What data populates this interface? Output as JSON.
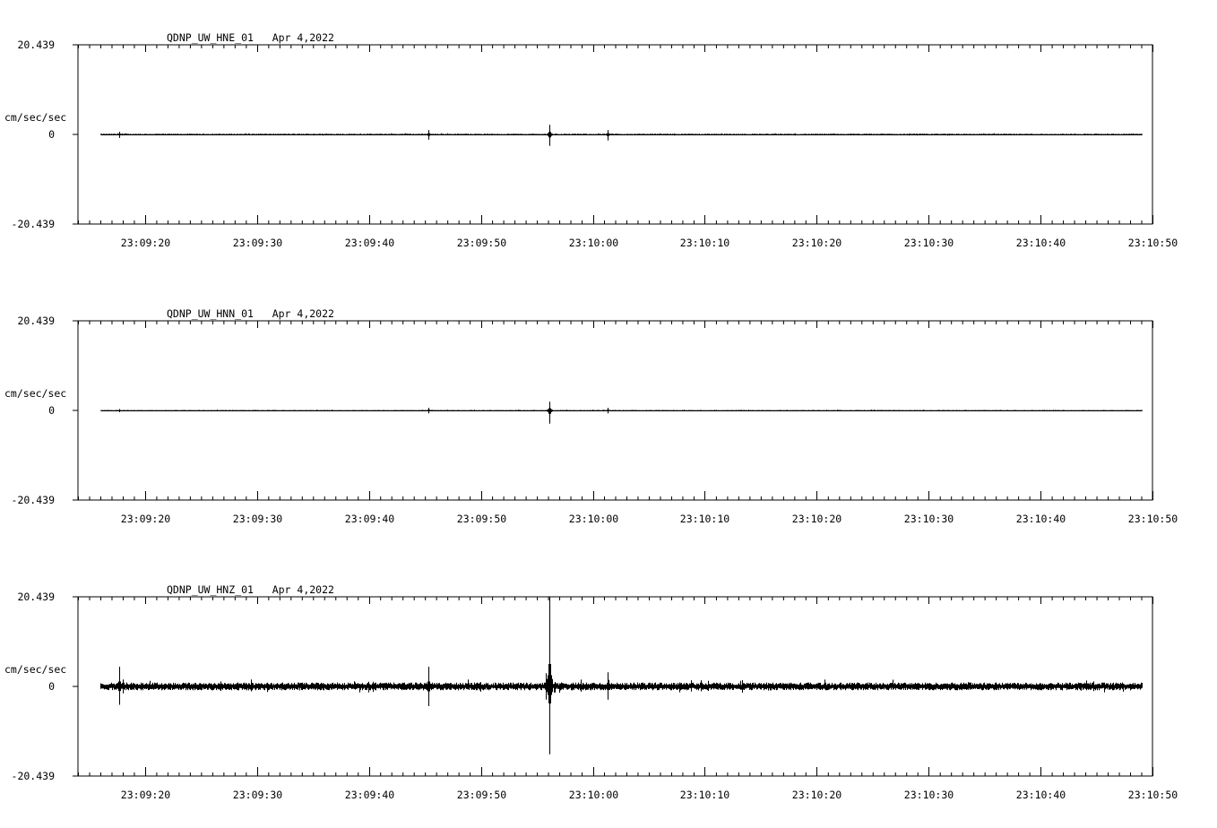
{
  "chart_data": [
    {
      "type": "line",
      "title": "QDNP_UW_HNE_01   Apr 4,2022",
      "ylabel": "cm/sec/sec",
      "ylim": [
        -20.439,
        20.439
      ],
      "ytick_labels": [
        "20.439",
        "0",
        "-20.439"
      ],
      "xlim": [
        "23:09:14",
        "23:10:50"
      ],
      "xtick_labels": [
        "23:09:20",
        "23:09:30",
        "23:09:40",
        "23:09:50",
        "23:10:00",
        "23:10:10",
        "23:10:20",
        "23:10:30",
        "23:10:40",
        "23:10:50"
      ],
      "x_range": [
        "23:09:16",
        "23:10:49"
      ],
      "noise_amplitude": 0.15,
      "spikes": [
        {
          "t": "23:09:17.7",
          "max": 0.6,
          "min": -0.8
        },
        {
          "t": "23:09:45.3",
          "max": 1.0,
          "min": -1.2
        },
        {
          "t": "23:09:56.1",
          "max": 2.2,
          "min": -2.6
        },
        {
          "t": "23:10:01.3",
          "max": 1.0,
          "min": -1.4
        }
      ]
    },
    {
      "type": "line",
      "title": "QDNP_UW_HNN_01   Apr 4,2022",
      "ylabel": "cm/sec/sec",
      "ylim": [
        -20.439,
        20.439
      ],
      "ytick_labels": [
        "20.439",
        "0",
        "-20.439"
      ],
      "xlim": [
        "23:09:14",
        "23:10:50"
      ],
      "xtick_labels": [
        "23:09:20",
        "23:09:30",
        "23:09:40",
        "23:09:50",
        "23:10:00",
        "23:10:10",
        "23:10:20",
        "23:10:30",
        "23:10:40",
        "23:10:50"
      ],
      "x_range": [
        "23:09:16",
        "23:10:49"
      ],
      "noise_amplitude": 0.1,
      "spikes": [
        {
          "t": "23:09:17.7",
          "max": 0.3,
          "min": -0.4
        },
        {
          "t": "23:09:45.3",
          "max": 0.6,
          "min": -0.7
        },
        {
          "t": "23:09:56.1",
          "max": 2.0,
          "min": -3.0
        },
        {
          "t": "23:10:01.3",
          "max": 0.6,
          "min": -0.7
        }
      ]
    },
    {
      "type": "line",
      "title": "QDNP_UW_HNZ_01   Apr 4,2022",
      "ylabel": "cm/sec/sec",
      "ylim": [
        -20.439,
        20.439
      ],
      "ytick_labels": [
        "20.439",
        "0",
        "-20.439"
      ],
      "xlim": [
        "23:09:14",
        "23:10:50"
      ],
      "xtick_labels": [
        "23:09:20",
        "23:09:30",
        "23:09:40",
        "23:09:50",
        "23:10:00",
        "23:10:10",
        "23:10:20",
        "23:10:30",
        "23:10:40",
        "23:10:50"
      ],
      "x_range": [
        "23:09:16",
        "23:10:49"
      ],
      "noise_amplitude": 0.9,
      "spikes": [
        {
          "t": "23:09:17.7",
          "max": 4.5,
          "min": -4.2
        },
        {
          "t": "23:09:45.3",
          "max": 4.5,
          "min": -4.5
        },
        {
          "t": "23:09:56.1",
          "max": 20.439,
          "min": -15.5
        },
        {
          "t": "23:09:55.8",
          "max": 3.0,
          "min": -3.0
        },
        {
          "t": "23:10:01.3",
          "max": 3.2,
          "min": -3.0
        }
      ]
    }
  ]
}
